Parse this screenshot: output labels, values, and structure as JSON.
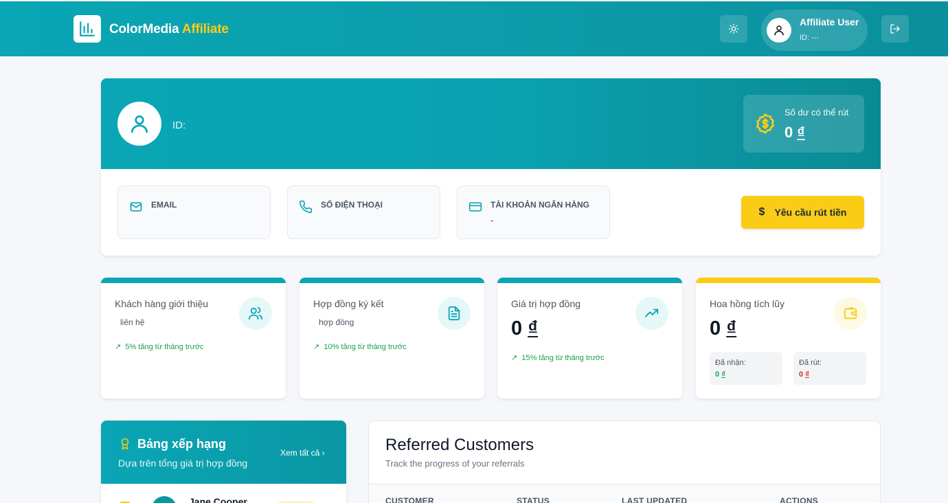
{
  "header": {
    "brand_main": "ColorMedia",
    "brand_accent": "Affiliate",
    "user_name": "Affiliate User",
    "user_id": "ID: ---",
    "theme_icon": "sun-icon",
    "logout_icon": "logout-icon"
  },
  "profile": {
    "id_label": "ID:",
    "balance_label": "Số dư có thể rút",
    "balance_value": "0",
    "currency": "₫",
    "email_label": "EMAIL",
    "email_value": "",
    "phone_label": "SỐ ĐIỆN THOẠI",
    "phone_value": "",
    "bank_label": "TÀI KHOẢN NGÂN HÀNG",
    "bank_value": "-",
    "withdraw_button": "Yêu cầu rút tiền"
  },
  "stats": [
    {
      "title": "Khách hàng giới thiệu",
      "sub": "liên hệ",
      "trend": "5% tăng từ tháng trước",
      "icon": "users-icon"
    },
    {
      "title": "Hợp đồng ký kết",
      "sub": "hợp đồng",
      "trend": "10% tăng từ tháng trước",
      "icon": "document-icon"
    },
    {
      "title": "Giá trị hợp đồng",
      "value": "0",
      "trend": "15% tăng từ tháng trước",
      "icon": "trending-up-icon"
    },
    {
      "title": "Hoa hồng tích lũy",
      "value": "0",
      "received_label": "Đã nhận:",
      "received_value": "0",
      "withdrawn_label": "Đã rút:",
      "withdrawn_value": "0",
      "icon": "wallet-icon"
    }
  ],
  "leaderboard": {
    "title": "Bảng xếp hạng",
    "subtitle": "Dựa trên tổng giá trị hợp đồng",
    "view_all": "Xem tất cả",
    "first_name": "Jane Cooper"
  },
  "referred": {
    "title": "Referred Customers",
    "subtitle": "Track the progress of your referrals",
    "columns": [
      "CUSTOMER",
      "STATUS",
      "LAST UPDATED",
      "ACTIONS"
    ]
  },
  "colors": {
    "teal": "#0aa6b5",
    "yellow": "#facc15",
    "green": "#16a34a",
    "red": "#dc2626"
  }
}
